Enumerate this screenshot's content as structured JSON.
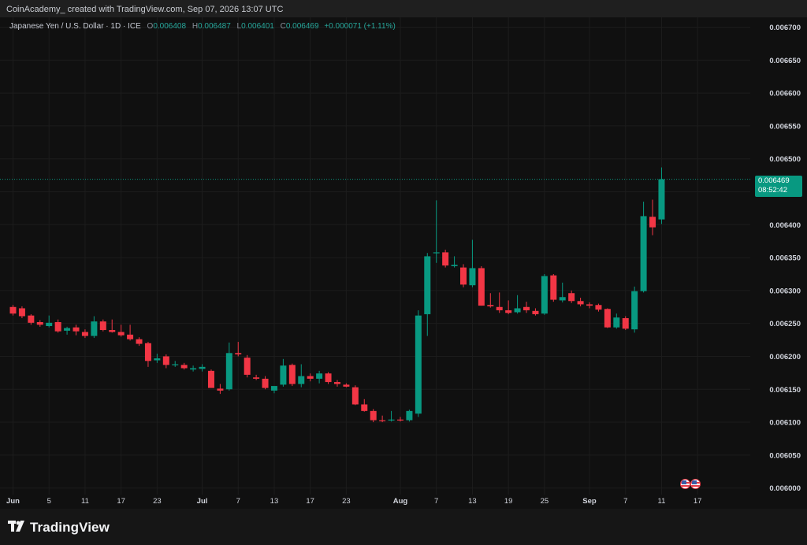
{
  "header": {
    "credit": "CoinAcademy_ created with TradingView.com, Sep 07, 2026 13:07 UTC"
  },
  "legend": {
    "symbol": "Japanese Yen / U.S. Dollar · 1D · ICE",
    "open_label": "O",
    "open": "0.006408",
    "high_label": "H",
    "high": "0.006487",
    "low_label": "L",
    "low": "0.006401",
    "close_label": "C",
    "close": "0.006469",
    "change": "+0.000071 (+1.11%)"
  },
  "price_label": {
    "price": "0.006469",
    "countdown": "08:52:42"
  },
  "footer": {
    "brand": "TradingView",
    "logo_icon": "tradingview-logo-icon"
  },
  "markers": {
    "icon": "us-flag-icon",
    "count": 2
  },
  "colors": {
    "up": "#089981",
    "down": "#f23645",
    "background": "#101010",
    "grid": "#1c1c1c",
    "axis_text": "#d1d4dc"
  },
  "chart_data": {
    "type": "candlestick",
    "title": "Japanese Yen / U.S. Dollar · 1D · ICE",
    "ylim": [
      0.00599,
      0.006715
    ],
    "y_ticks": [
      0.006,
      0.00605,
      0.0061,
      0.00615,
      0.0062,
      0.00625,
      0.0063,
      0.00635,
      0.0064,
      0.00645,
      0.0065,
      0.00655,
      0.0066,
      0.00665,
      0.0067
    ],
    "y_tick_labels": [
      "0.006000",
      "0.006050",
      "0.006100",
      "0.006150",
      "0.006200",
      "0.006250",
      "0.006300",
      "0.006350",
      "0.006400",
      "0.006450",
      "0.006500",
      "0.006550",
      "0.006600",
      "0.006650",
      "0.006700"
    ],
    "x_tick_labels": [
      "Jun",
      "5",
      "11",
      "17",
      "23",
      "Jul",
      "7",
      "13",
      "17",
      "23",
      "Aug",
      "7",
      "13",
      "19",
      "25",
      "Sep",
      "7",
      "11",
      "17"
    ],
    "x_tick_slots": [
      0,
      4,
      8,
      12,
      16,
      21,
      25,
      29,
      33,
      37,
      43,
      47,
      51,
      55,
      59,
      64,
      68,
      72,
      76
    ],
    "last_price": 0.006469,
    "candles": [
      {
        "o": 0.006275,
        "h": 0.006278,
        "l": 0.006262,
        "c": 0.006265
      },
      {
        "o": 0.006273,
        "h": 0.006276,
        "l": 0.006258,
        "c": 0.006261
      },
      {
        "o": 0.006262,
        "h": 0.006264,
        "l": 0.006248,
        "c": 0.006251
      },
      {
        "o": 0.006252,
        "h": 0.006255,
        "l": 0.006245,
        "c": 0.006248
      },
      {
        "o": 0.006246,
        "h": 0.006262,
        "l": 0.006244,
        "c": 0.006251
      },
      {
        "o": 0.006252,
        "h": 0.006256,
        "l": 0.006236,
        "c": 0.006238
      },
      {
        "o": 0.006239,
        "h": 0.006245,
        "l": 0.006233,
        "c": 0.006243
      },
      {
        "o": 0.006244,
        "h": 0.006248,
        "l": 0.006232,
        "c": 0.006238
      },
      {
        "o": 0.006237,
        "h": 0.006241,
        "l": 0.006228,
        "c": 0.006231
      },
      {
        "o": 0.006231,
        "h": 0.006261,
        "l": 0.006228,
        "c": 0.006253
      },
      {
        "o": 0.006253,
        "h": 0.006256,
        "l": 0.006238,
        "c": 0.00624
      },
      {
        "o": 0.00624,
        "h": 0.006256,
        "l": 0.006236,
        "c": 0.006237
      },
      {
        "o": 0.006237,
        "h": 0.006248,
        "l": 0.00623,
        "c": 0.006232
      },
      {
        "o": 0.006233,
        "h": 0.006248,
        "l": 0.006224,
        "c": 0.006226
      },
      {
        "o": 0.006226,
        "h": 0.006229,
        "l": 0.006216,
        "c": 0.006219
      },
      {
        "o": 0.00622,
        "h": 0.006222,
        "l": 0.006184,
        "c": 0.006193
      },
      {
        "o": 0.006194,
        "h": 0.006204,
        "l": 0.00619,
        "c": 0.006197
      },
      {
        "o": 0.0062,
        "h": 0.006203,
        "l": 0.006182,
        "c": 0.006187
      },
      {
        "o": 0.006187,
        "h": 0.006193,
        "l": 0.006184,
        "c": 0.006188
      },
      {
        "o": 0.006187,
        "h": 0.00619,
        "l": 0.00618,
        "c": 0.006182
      },
      {
        "o": 0.00618,
        "h": 0.006186,
        "l": 0.006177,
        "c": 0.006182
      },
      {
        "o": 0.006181,
        "h": 0.006188,
        "l": 0.006177,
        "c": 0.006184
      },
      {
        "o": 0.006178,
        "h": 0.00618,
        "l": 0.00616,
        "c": 0.006152
      },
      {
        "o": 0.006151,
        "h": 0.006158,
        "l": 0.006143,
        "c": 0.006148
      },
      {
        "o": 0.00615,
        "h": 0.006221,
        "l": 0.006148,
        "c": 0.006205
      },
      {
        "o": 0.006205,
        "h": 0.006222,
        "l": 0.0062,
        "c": 0.006203
      },
      {
        "o": 0.006198,
        "h": 0.006202,
        "l": 0.006168,
        "c": 0.006172
      },
      {
        "o": 0.006168,
        "h": 0.006172,
        "l": 0.006164,
        "c": 0.006166
      },
      {
        "o": 0.006166,
        "h": 0.00617,
        "l": 0.00615,
        "c": 0.006152
      },
      {
        "o": 0.006148,
        "h": 0.006152,
        "l": 0.006144,
        "c": 0.006155
      },
      {
        "o": 0.006157,
        "h": 0.006196,
        "l": 0.006154,
        "c": 0.006186
      },
      {
        "o": 0.006187,
        "h": 0.006189,
        "l": 0.006155,
        "c": 0.006158
      },
      {
        "o": 0.006158,
        "h": 0.006188,
        "l": 0.006153,
        "c": 0.00617
      },
      {
        "o": 0.00617,
        "h": 0.006174,
        "l": 0.006162,
        "c": 0.006166
      },
      {
        "o": 0.006166,
        "h": 0.006178,
        "l": 0.006159,
        "c": 0.006174
      },
      {
        "o": 0.006174,
        "h": 0.006176,
        "l": 0.006158,
        "c": 0.006161
      },
      {
        "o": 0.006161,
        "h": 0.006164,
        "l": 0.006154,
        "c": 0.006158
      },
      {
        "o": 0.006157,
        "h": 0.006159,
        "l": 0.006153,
        "c": 0.006154
      },
      {
        "o": 0.006153,
        "h": 0.006156,
        "l": 0.006126,
        "c": 0.006127
      },
      {
        "o": 0.006127,
        "h": 0.006135,
        "l": 0.006116,
        "c": 0.006117
      },
      {
        "o": 0.006117,
        "h": 0.00612,
        "l": 0.0061,
        "c": 0.006103
      },
      {
        "o": 0.006103,
        "h": 0.00611,
        "l": 0.0061,
        "c": 0.006102
      },
      {
        "o": 0.006103,
        "h": 0.006117,
        "l": 0.006101,
        "c": 0.006104
      },
      {
        "o": 0.006104,
        "h": 0.006108,
        "l": 0.006101,
        "c": 0.006103
      },
      {
        "o": 0.006103,
        "h": 0.006119,
        "l": 0.006101,
        "c": 0.006117
      },
      {
        "o": 0.006113,
        "h": 0.00627,
        "l": 0.006108,
        "c": 0.006262
      },
      {
        "o": 0.006264,
        "h": 0.006357,
        "l": 0.006231,
        "c": 0.006352
      },
      {
        "o": 0.006357,
        "h": 0.006437,
        "l": 0.006342,
        "c": 0.006358
      },
      {
        "o": 0.006358,
        "h": 0.006362,
        "l": 0.006335,
        "c": 0.006338
      },
      {
        "o": 0.006337,
        "h": 0.006352,
        "l": 0.006335,
        "c": 0.006339
      },
      {
        "o": 0.006335,
        "h": 0.00634,
        "l": 0.006305,
        "c": 0.006309
      },
      {
        "o": 0.006308,
        "h": 0.006377,
        "l": 0.006305,
        "c": 0.006334
      },
      {
        "o": 0.006334,
        "h": 0.006337,
        "l": 0.006277,
        "c": 0.006277
      },
      {
        "o": 0.006278,
        "h": 0.006296,
        "l": 0.006274,
        "c": 0.006276
      },
      {
        "o": 0.006275,
        "h": 0.006297,
        "l": 0.006266,
        "c": 0.00627
      },
      {
        "o": 0.00627,
        "h": 0.006285,
        "l": 0.006264,
        "c": 0.006266
      },
      {
        "o": 0.006267,
        "h": 0.006293,
        "l": 0.006265,
        "c": 0.006273
      },
      {
        "o": 0.006275,
        "h": 0.006283,
        "l": 0.006266,
        "c": 0.00627
      },
      {
        "o": 0.006269,
        "h": 0.006273,
        "l": 0.006262,
        "c": 0.006264
      },
      {
        "o": 0.006265,
        "h": 0.006325,
        "l": 0.006263,
        "c": 0.006322
      },
      {
        "o": 0.006323,
        "h": 0.006325,
        "l": 0.006283,
        "c": 0.006286
      },
      {
        "o": 0.006285,
        "h": 0.006312,
        "l": 0.006282,
        "c": 0.00629
      },
      {
        "o": 0.006296,
        "h": 0.0063,
        "l": 0.006281,
        "c": 0.006284
      },
      {
        "o": 0.006284,
        "h": 0.006289,
        "l": 0.006276,
        "c": 0.006279
      },
      {
        "o": 0.006279,
        "h": 0.006282,
        "l": 0.006273,
        "c": 0.006277
      },
      {
        "o": 0.006278,
        "h": 0.00628,
        "l": 0.006268,
        "c": 0.006271
      },
      {
        "o": 0.006272,
        "h": 0.006273,
        "l": 0.006243,
        "c": 0.006244
      },
      {
        "o": 0.006244,
        "h": 0.006265,
        "l": 0.006242,
        "c": 0.006259
      },
      {
        "o": 0.006258,
        "h": 0.006261,
        "l": 0.00624,
        "c": 0.006242
      },
      {
        "o": 0.006241,
        "h": 0.006306,
        "l": 0.006236,
        "c": 0.006299
      },
      {
        "o": 0.006299,
        "h": 0.006435,
        "l": 0.006297,
        "c": 0.006413
      },
      {
        "o": 0.006412,
        "h": 0.006438,
        "l": 0.006384,
        "c": 0.006396
      },
      {
        "o": 0.006408,
        "h": 0.006487,
        "l": 0.006401,
        "c": 0.006469
      }
    ]
  }
}
